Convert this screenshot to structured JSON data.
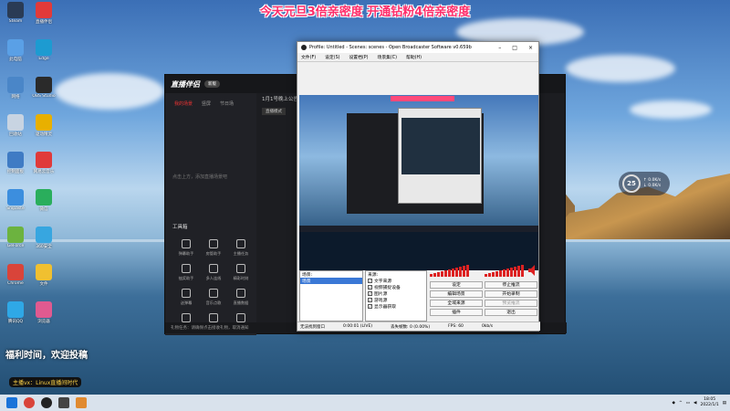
{
  "banner": "今天元旦3倍亲密度 开通钻粉4倍亲密度",
  "desktop_icons": [
    {
      "label": "Steam",
      "color": "#2a3b55"
    },
    {
      "label": "此电脑",
      "color": "#5aa0e6"
    },
    {
      "label": "网络",
      "color": "#4a86c8"
    },
    {
      "label": "回收站",
      "color": "#c8d4e2"
    },
    {
      "label": "控制面板",
      "color": "#3f7bc4"
    },
    {
      "label": "Snipaste",
      "color": "#3c8ede"
    },
    {
      "label": "GeForce",
      "color": "#6cb33f"
    },
    {
      "label": "Chrome",
      "color": "#d9443a"
    },
    {
      "label": "腾讯QQ",
      "color": "#2fa8e6"
    },
    {
      "label": "直播伴侣",
      "color": "#e23a3a"
    },
    {
      "label": "Edge",
      "color": "#1d9bd1"
    },
    {
      "label": "OBS Studio",
      "color": "#2a2a2a"
    },
    {
      "label": "驱动精灵",
      "color": "#e8b000"
    },
    {
      "label": "网易云音乐",
      "color": "#e03a3a"
    },
    {
      "label": "微信",
      "color": "#2aae5c"
    },
    {
      "label": "360安全",
      "color": "#37a6e0"
    },
    {
      "label": "文件",
      "color": "#f0c030"
    },
    {
      "label": "浏览器",
      "color": "#e05a90"
    }
  ],
  "live_app": {
    "name": "直播伴侣",
    "version": "新版",
    "tabs": [
      "我的场景",
      "竖屏",
      "节日场"
    ],
    "empty_text": "点击上方，添加直播场景吧",
    "tools_title": "工具箱",
    "tools": [
      "弹幕助手",
      "房管助手",
      "主播任务",
      "抽奖助手",
      "多人连线",
      "精彩时刻",
      "送弹幕",
      "音乐点歌",
      "直播数据",
      "礼物发送",
      "PK",
      "更多"
    ],
    "notice": "1月1号晚上公告",
    "pill": "直播模式",
    "bottom_text": "礼物任务：请确保点击接收礼物，取消通知"
  },
  "obs": {
    "title": "Profile: Untitled - Scenes: scenes - Open Broadcaster Software v0.659b",
    "menu": [
      "文件(F)",
      "设定(S)",
      "设置档(P)",
      "场景集(C)",
      "帮助(H)"
    ],
    "scenes_header": "场景:",
    "scenes": [
      "场景"
    ],
    "sources_header": "来源:",
    "sources": [
      "文字来源",
      "视频捕捉设备",
      "图片源",
      "游戏源",
      "显示器获取"
    ],
    "buttons": [
      "设定",
      "停止推流",
      "编辑场景",
      "开始录制",
      "全域来源",
      "预览推流",
      "插件",
      "退出"
    ],
    "status": [
      "无法找到窗口",
      "0:00:01 (LIVE)",
      "丢失帧数: 0 (0.00%)",
      "FPS: 60",
      "0kb/s"
    ]
  },
  "weather": {
    "value": "25",
    "unit1": "↑ 0.0K/s",
    "unit2": "↓ 0.0K/s"
  },
  "overlay": {
    "line1": "福利时间，欢迎投稿",
    "line2": "主播vx：Linux直播间时代"
  },
  "taskbar": {
    "time": "18:05",
    "date": "2022/1/1"
  }
}
